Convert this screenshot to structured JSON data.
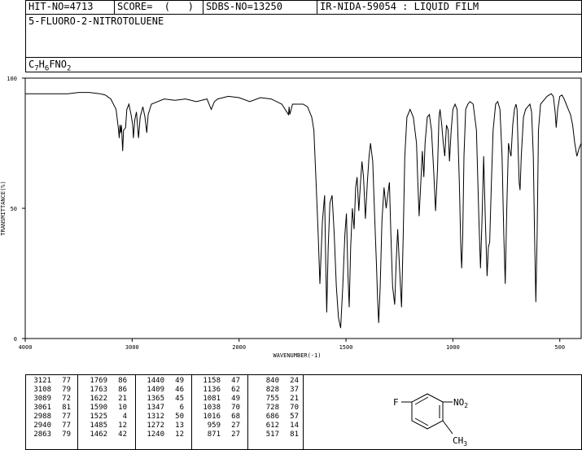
{
  "header": {
    "hit_no": "HIT-NO=4713",
    "score": "SCORE=  (   )",
    "sdbs_no": "SDBS-NO=13250",
    "method": "IR-NIDA-59054 : LIQUID FILM"
  },
  "compound_name": "5-FLUORO-2-NITROTOLUENE",
  "formula": "C7H6FNO2",
  "formula_parts": {
    "c": "C",
    "c_sub": "7",
    "h": "H",
    "h_sub": "6",
    "rest": "FNO",
    "o_sub": "2"
  },
  "structure_labels": {
    "fluoro": "F",
    "nitro": "NO",
    "nitro_sub": "2",
    "methyl": "CH",
    "methyl_sub": "3"
  },
  "peak_table": {
    "columns": [
      [
        [
          "3121",
          "77"
        ],
        [
          "3108",
          "79"
        ],
        [
          "3089",
          "72"
        ],
        [
          "3061",
          "81"
        ],
        [
          "2988",
          "77"
        ],
        [
          "2940",
          "77"
        ],
        [
          "2863",
          "79"
        ]
      ],
      [
        [
          "1769",
          "86"
        ],
        [
          "1763",
          "86"
        ],
        [
          "1622",
          "21"
        ],
        [
          "1590",
          "10"
        ],
        [
          "1525",
          "4"
        ],
        [
          "1485",
          "12"
        ],
        [
          "1462",
          "42"
        ]
      ],
      [
        [
          "1440",
          "49"
        ],
        [
          "1409",
          "46"
        ],
        [
          "1365",
          "45"
        ],
        [
          "1347",
          "6"
        ],
        [
          "1312",
          "50"
        ],
        [
          "1272",
          "13"
        ],
        [
          "1240",
          "12"
        ]
      ],
      [
        [
          "1158",
          "47"
        ],
        [
          "1136",
          "62"
        ],
        [
          "1081",
          "49"
        ],
        [
          "1038",
          "70"
        ],
        [
          "1016",
          "68"
        ],
        [
          "959",
          "27"
        ],
        [
          "871",
          "27"
        ]
      ],
      [
        [
          "840",
          "24"
        ],
        [
          "828",
          "37"
        ],
        [
          "755",
          "21"
        ],
        [
          "728",
          "70"
        ],
        [
          "686",
          "57"
        ],
        [
          "612",
          "14"
        ],
        [
          "517",
          "81"
        ]
      ]
    ]
  },
  "chart_data": {
    "type": "line",
    "xlabel": "WAVENUMBER(-1)",
    "ylabel": "TRANSMITTANCE(%)",
    "xlim": [
      4000,
      400
    ],
    "ylim": [
      0,
      100
    ],
    "x_ticks": [
      4000,
      3000,
      2000,
      1500,
      1000,
      500
    ],
    "x_tick_labels": [
      "4000",
      "3000",
      "2000",
      "1500",
      "1000",
      "500"
    ],
    "y_ticks": [
      0,
      50,
      100
    ],
    "y_tick_labels": [
      "0",
      "50",
      "100"
    ],
    "grid": false,
    "series": [
      {
        "points": [
          [
            4000,
            94
          ],
          [
            3900,
            94
          ],
          [
            3800,
            94
          ],
          [
            3700,
            94
          ],
          [
            3600,
            94
          ],
          [
            3500,
            94.5
          ],
          [
            3400,
            94.5
          ],
          [
            3300,
            94
          ],
          [
            3250,
            93.5
          ],
          [
            3200,
            92
          ],
          [
            3150,
            88
          ],
          [
            3130,
            81
          ],
          [
            3121,
            77
          ],
          [
            3114,
            82
          ],
          [
            3108,
            79
          ],
          [
            3100,
            82
          ],
          [
            3089,
            72
          ],
          [
            3080,
            80
          ],
          [
            3061,
            81
          ],
          [
            3050,
            88
          ],
          [
            3030,
            90
          ],
          [
            3010,
            86
          ],
          [
            2995,
            82
          ],
          [
            2988,
            77
          ],
          [
            2975,
            84
          ],
          [
            2960,
            87
          ],
          [
            2940,
            77
          ],
          [
            2925,
            85
          ],
          [
            2900,
            89
          ],
          [
            2880,
            85
          ],
          [
            2863,
            79
          ],
          [
            2850,
            86
          ],
          [
            2820,
            90
          ],
          [
            2700,
            92
          ],
          [
            2600,
            91.5
          ],
          [
            2500,
            92
          ],
          [
            2400,
            91
          ],
          [
            2300,
            92
          ],
          [
            2260,
            88
          ],
          [
            2230,
            91
          ],
          [
            2200,
            92
          ],
          [
            2100,
            93
          ],
          [
            2000,
            92.5
          ],
          [
            1950,
            91
          ],
          [
            1900,
            92.5
          ],
          [
            1850,
            92
          ],
          [
            1800,
            90
          ],
          [
            1769,
            86
          ],
          [
            1766,
            89
          ],
          [
            1763,
            86
          ],
          [
            1750,
            90
          ],
          [
            1700,
            90
          ],
          [
            1680,
            89
          ],
          [
            1660,
            85
          ],
          [
            1650,
            80
          ],
          [
            1640,
            60
          ],
          [
            1630,
            40
          ],
          [
            1622,
            21
          ],
          [
            1610,
            45
          ],
          [
            1600,
            55
          ],
          [
            1595,
            30
          ],
          [
            1590,
            10
          ],
          [
            1583,
            35
          ],
          [
            1575,
            52
          ],
          [
            1565,
            55
          ],
          [
            1555,
            40
          ],
          [
            1545,
            20
          ],
          [
            1535,
            8
          ],
          [
            1525,
            4
          ],
          [
            1515,
            20
          ],
          [
            1505,
            40
          ],
          [
            1498,
            48
          ],
          [
            1491,
            25
          ],
          [
            1485,
            12
          ],
          [
            1478,
            35
          ],
          [
            1470,
            50
          ],
          [
            1462,
            42
          ],
          [
            1455,
            58
          ],
          [
            1448,
            62
          ],
          [
            1440,
            49
          ],
          [
            1432,
            60
          ],
          [
            1425,
            68
          ],
          [
            1418,
            62
          ],
          [
            1409,
            46
          ],
          [
            1400,
            60
          ],
          [
            1392,
            70
          ],
          [
            1385,
            75
          ],
          [
            1375,
            68
          ],
          [
            1365,
            45
          ],
          [
            1358,
            30
          ],
          [
            1352,
            15
          ],
          [
            1347,
            6
          ],
          [
            1340,
            20
          ],
          [
            1332,
            45
          ],
          [
            1322,
            58
          ],
          [
            1312,
            50
          ],
          [
            1305,
            55
          ],
          [
            1297,
            60
          ],
          [
            1290,
            40
          ],
          [
            1282,
            20
          ],
          [
            1272,
            13
          ],
          [
            1265,
            30
          ],
          [
            1258,
            42
          ],
          [
            1250,
            28
          ],
          [
            1240,
            12
          ],
          [
            1232,
            40
          ],
          [
            1225,
            70
          ],
          [
            1215,
            85
          ],
          [
            1200,
            88
          ],
          [
            1185,
            85
          ],
          [
            1170,
            75
          ],
          [
            1164,
            60
          ],
          [
            1158,
            47
          ],
          [
            1150,
            60
          ],
          [
            1143,
            72
          ],
          [
            1136,
            62
          ],
          [
            1130,
            75
          ],
          [
            1120,
            85
          ],
          [
            1110,
            86
          ],
          [
            1100,
            80
          ],
          [
            1090,
            65
          ],
          [
            1081,
            49
          ],
          [
            1072,
            65
          ],
          [
            1065,
            85
          ],
          [
            1060,
            88
          ],
          [
            1052,
            82
          ],
          [
            1045,
            75
          ],
          [
            1038,
            70
          ],
          [
            1030,
            82
          ],
          [
            1022,
            80
          ],
          [
            1016,
            68
          ],
          [
            1008,
            80
          ],
          [
            1000,
            88
          ],
          [
            990,
            90
          ],
          [
            980,
            88
          ],
          [
            970,
            60
          ],
          [
            963,
            35
          ],
          [
            959,
            27
          ],
          [
            954,
            40
          ],
          [
            948,
            70
          ],
          [
            940,
            88
          ],
          [
            930,
            90
          ],
          [
            920,
            91
          ],
          [
            905,
            90
          ],
          [
            890,
            80
          ],
          [
            878,
            45
          ],
          [
            871,
            27
          ],
          [
            864,
            45
          ],
          [
            856,
            70
          ],
          [
            848,
            45
          ],
          [
            840,
            24
          ],
          [
            834,
            35
          ],
          [
            828,
            37
          ],
          [
            820,
            60
          ],
          [
            812,
            80
          ],
          [
            800,
            90
          ],
          [
            790,
            91
          ],
          [
            780,
            88
          ],
          [
            770,
            70
          ],
          [
            762,
            40
          ],
          [
            755,
            21
          ],
          [
            748,
            50
          ],
          [
            740,
            75
          ],
          [
            734,
            72
          ],
          [
            728,
            70
          ],
          [
            720,
            82
          ],
          [
            712,
            88
          ],
          [
            705,
            90
          ],
          [
            700,
            88
          ],
          [
            694,
            70
          ],
          [
            690,
            60
          ],
          [
            686,
            57
          ],
          [
            680,
            70
          ],
          [
            670,
            85
          ],
          [
            660,
            88
          ],
          [
            650,
            89
          ],
          [
            640,
            90
          ],
          [
            632,
            87
          ],
          [
            624,
            70
          ],
          [
            618,
            40
          ],
          [
            612,
            14
          ],
          [
            606,
            40
          ],
          [
            600,
            80
          ],
          [
            590,
            90
          ],
          [
            580,
            91
          ],
          [
            560,
            93
          ],
          [
            540,
            94
          ],
          [
            530,
            93
          ],
          [
            522,
            87
          ],
          [
            517,
            81
          ],
          [
            510,
            88
          ],
          [
            500,
            93
          ],
          [
            490,
            93.5
          ],
          [
            480,
            92
          ],
          [
            470,
            90
          ],
          [
            460,
            88
          ],
          [
            450,
            86
          ],
          [
            440,
            82
          ],
          [
            430,
            75
          ],
          [
            420,
            70
          ],
          [
            410,
            73
          ],
          [
            400,
            75
          ]
        ]
      }
    ]
  }
}
